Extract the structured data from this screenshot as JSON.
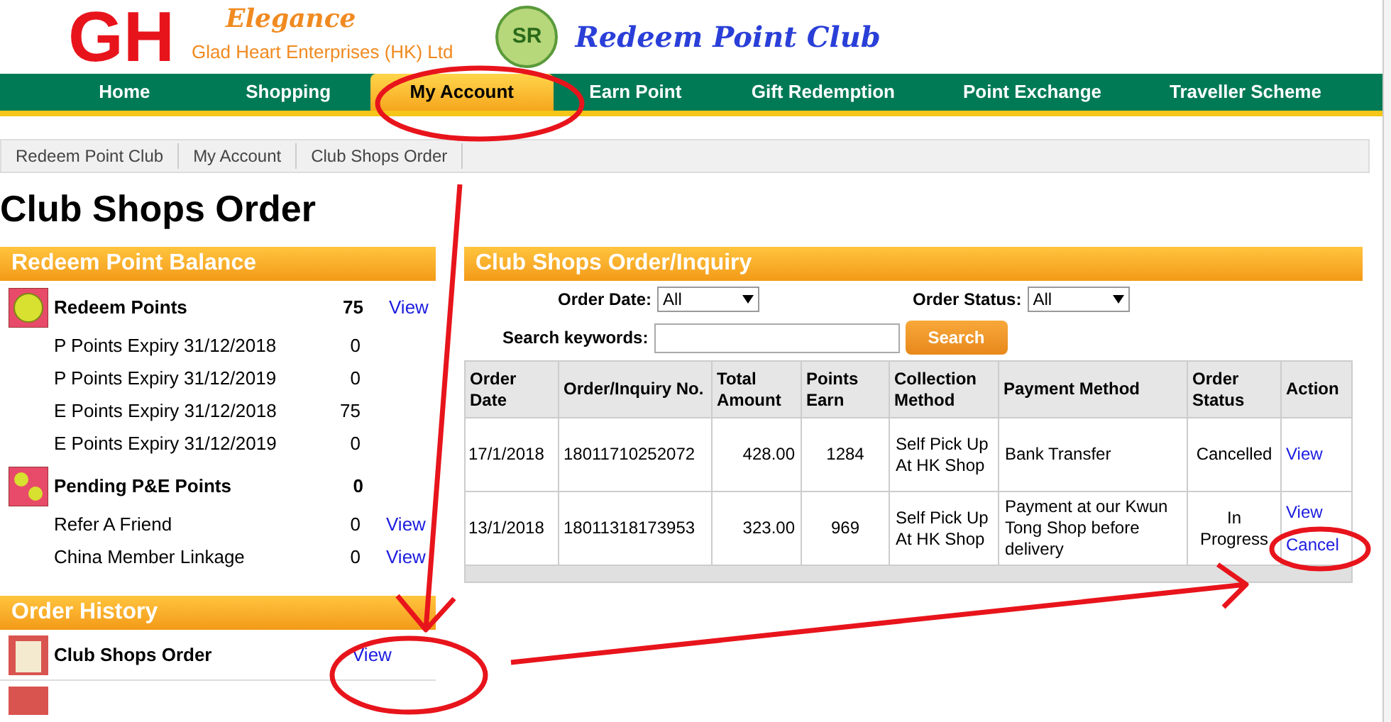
{
  "logo": {
    "mark": "GH",
    "brand": "Elegance",
    "company": "Glad Heart Enterprises (HK) Ltd",
    "badge": "SR",
    "club": "Redeem Point Club"
  },
  "nav": [
    {
      "label": "Home",
      "selected": false
    },
    {
      "label": "Shopping",
      "selected": false
    },
    {
      "label": "My Account",
      "selected": true
    },
    {
      "label": "Earn Point",
      "selected": false
    },
    {
      "label": "Gift Redemption",
      "selected": false
    },
    {
      "label": "Point Exchange",
      "selected": false
    },
    {
      "label": "Traveller Scheme",
      "selected": false
    }
  ],
  "breadcrumb": [
    "Redeem Point Club",
    "My Account",
    "Club Shops Order"
  ],
  "page_title": "Club Shops Order",
  "balance": {
    "title": "Redeem Point Balance",
    "items": [
      {
        "kind": "redeem",
        "label": "Redeem Points",
        "value": "75",
        "link": "View"
      },
      {
        "kind": "sub",
        "label": "P Points Expiry 31/12/2018",
        "value": "0"
      },
      {
        "kind": "sub",
        "label": "P Points Expiry 31/12/2019",
        "value": "0"
      },
      {
        "kind": "sub",
        "label": "E Points Expiry 31/12/2018",
        "value": "75"
      },
      {
        "kind": "sub",
        "label": "E Points Expiry 31/12/2019",
        "value": "0"
      },
      {
        "kind": "pending",
        "label": "Pending P&E Points",
        "value": "0"
      },
      {
        "kind": "sub",
        "label": "Refer A Friend",
        "value": "0",
        "link": "View"
      },
      {
        "kind": "sub",
        "label": "China Member Linkage",
        "value": "0",
        "link": "View"
      }
    ]
  },
  "history": {
    "title": "Order History",
    "items": [
      {
        "label": "Club Shops Order",
        "link": "View"
      }
    ]
  },
  "orders": {
    "title": "Club Shops Order/Inquiry",
    "filters": [
      {
        "label": "Order Date:",
        "value": "All"
      },
      {
        "label": "Order Status:",
        "value": "All"
      }
    ],
    "search": {
      "label": "Search keywords:",
      "button": "Search"
    },
    "columns": [
      "Order Date",
      "Order/Inquiry No.",
      "Total Amount",
      "Points Earn",
      "Collection Method",
      "Payment Method",
      "Order Status",
      "Action"
    ],
    "rows": [
      {
        "date": "17/1/2018",
        "number": "18011710252072",
        "amount": "428.00",
        "points": "1284",
        "collection": "Self Pick Up At HK Shop",
        "payment": "Bank Transfer",
        "status": "Cancelled",
        "actions": [
          "View"
        ]
      },
      {
        "date": "13/1/2018",
        "number": "18011318173953",
        "amount": "323.00",
        "points": "969",
        "collection": "Self Pick Up At HK Shop",
        "payment": "Payment at our Kwun Tong Shop before delivery",
        "status": "In Progress",
        "actions": [
          "View",
          "Cancel"
        ]
      }
    ]
  }
}
